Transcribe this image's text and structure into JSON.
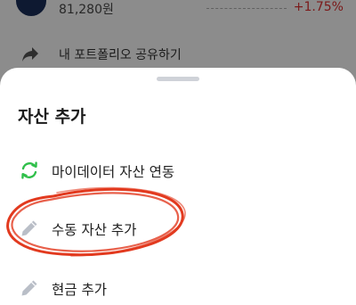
{
  "background": {
    "asset_amount": "81,280원",
    "asset_change": "+1.75%",
    "share_label": "내 포트폴리오 공유하기"
  },
  "sheet": {
    "title": "자산 추가",
    "items": [
      {
        "label": "마이데이터 자산 연동",
        "icon": "sync-icon",
        "icon_color": "#2fbf4a"
      },
      {
        "label": "수동 자산 추가",
        "icon": "pencil-icon",
        "icon_color": "#b9bec7"
      },
      {
        "label": "현금 추가",
        "icon": "pencil-icon",
        "icon_color": "#b9bec7"
      }
    ]
  },
  "colors": {
    "change_positive": "#e03030",
    "annotation": "#e23a1f"
  }
}
